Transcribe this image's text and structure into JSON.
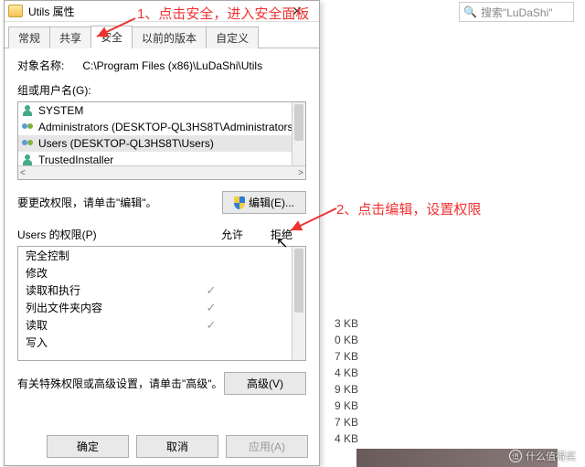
{
  "window": {
    "title": "Utils 属性",
    "close_glyph": "✕"
  },
  "tabs": [
    "常规",
    "共享",
    "安全",
    "以前的版本",
    "自定义"
  ],
  "active_tab_index": 2,
  "object_name_label": "对象名称:",
  "object_path": "C:\\Program Files (x86)\\LuDaShi\\Utils",
  "groups_label": "组或用户名(G):",
  "principals": [
    {
      "icon": "person",
      "name": "SYSTEM",
      "sel": false
    },
    {
      "icon": "group",
      "name": "Administrators (DESKTOP-QL3HS8T\\Administrators)",
      "sel": false
    },
    {
      "icon": "group",
      "name": "Users (DESKTOP-QL3HS8T\\Users)",
      "sel": true
    },
    {
      "icon": "person",
      "name": "TrustedInstaller",
      "sel": false
    }
  ],
  "edit_hint": "要更改权限，请单击\"编辑\"。",
  "edit_button": "编辑(E)...",
  "perm_header": {
    "title": "Users 的权限(P)",
    "allow": "允许",
    "deny": "拒绝"
  },
  "permissions": [
    {
      "name": "完全控制",
      "allow": false,
      "deny": false
    },
    {
      "name": "修改",
      "allow": false,
      "deny": false
    },
    {
      "name": "读取和执行",
      "allow": true,
      "deny": false
    },
    {
      "name": "列出文件夹内容",
      "allow": true,
      "deny": false
    },
    {
      "name": "读取",
      "allow": true,
      "deny": false
    },
    {
      "name": "写入",
      "allow": false,
      "deny": false
    }
  ],
  "adv_hint": "有关特殊权限或高级设置，请单击\"高级\"。",
  "adv_button": "高级(V)",
  "buttons": {
    "ok": "确定",
    "cancel": "取消",
    "apply": "应用(A)"
  },
  "annotations": {
    "a1": "1、点击安全，进入安全面板",
    "a2": "2、点击编辑，设置权限"
  },
  "background": {
    "search_placeholder": "搜索\"LuDaShi\"",
    "file_sizes": [
      "3 KB",
      "0 KB",
      "7 KB",
      "4 KB",
      "9 KB",
      "9 KB",
      "7 KB",
      "4 KB"
    ],
    "watermark": "什么值得买"
  }
}
